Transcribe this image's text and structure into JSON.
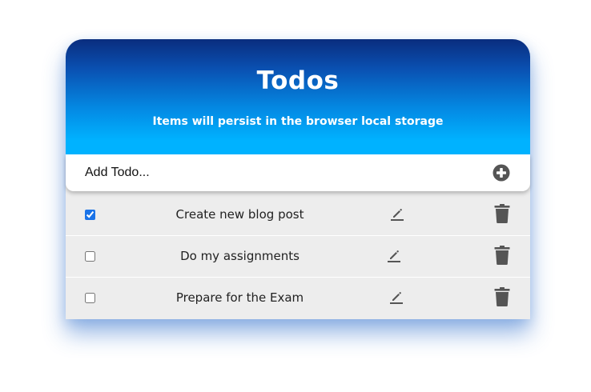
{
  "header": {
    "title": "Todos",
    "subtitle": "Items will persist in the browser local storage"
  },
  "add_todo": {
    "placeholder": "Add Todo...",
    "button_icon": "plus-circle-icon"
  },
  "todos": [
    {
      "label": "Create new blog post",
      "checked": true
    },
    {
      "label": "Do my assignments",
      "checked": false
    },
    {
      "label": "Prepare for the Exam",
      "checked": false
    }
  ],
  "icons": {
    "edit": "pencil-icon",
    "delete": "trash-icon"
  },
  "colors": {
    "header_top": "#0a2d7e",
    "header_bottom": "#00b2ff",
    "row_background": "#ededed",
    "icon": "#555555",
    "checkbox_accent": "#1a73e8"
  }
}
